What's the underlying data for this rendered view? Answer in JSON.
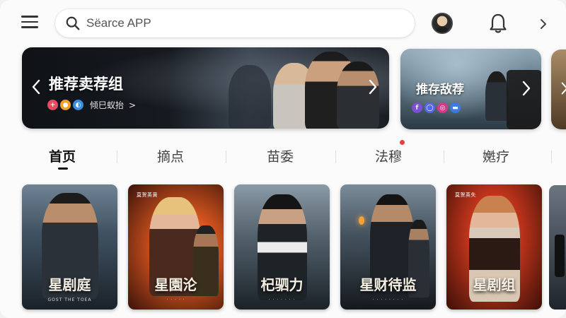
{
  "search": {
    "placeholder": "Sëarce APP"
  },
  "banners": [
    {
      "title": "推荐卖荐组",
      "subtitle": "倾巳蚁抬",
      "chevron": ">",
      "dots": [
        {
          "glyph": "+",
          "color": "#e84a5f"
        },
        {
          "glyph": "●",
          "color": "#f0a030"
        },
        {
          "glyph": "◐",
          "color": "#3a8fe0"
        }
      ]
    },
    {
      "title": "推存敌荐",
      "dots": [
        {
          "glyph": "f",
          "color": "#7b4fd6"
        },
        {
          "glyph": "◯",
          "color": "#5468e8"
        },
        {
          "glyph": "◎",
          "color": "#d6398a"
        },
        {
          "glyph": "▬",
          "color": "#3b7be6"
        }
      ]
    }
  ],
  "tabs": [
    {
      "label": "首页",
      "active": true
    },
    {
      "label": "摘点",
      "active": false
    },
    {
      "label": "苗委",
      "active": false
    },
    {
      "label": "法穆",
      "active": false,
      "badge": true
    },
    {
      "label": "嬎疗",
      "active": false
    }
  ],
  "posters": [
    {
      "title": "星剧庭",
      "top_text": "",
      "foot": "GOST THE TOEA",
      "theme": "#3f5161",
      "theme2": "#1a2229"
    },
    {
      "title": "星園沦",
      "top_text": "莫贺英黄",
      "foot": "· · · · ·",
      "theme": "#d9561f",
      "theme2": "#3a130a"
    },
    {
      "title": "杞驷力",
      "top_text": "",
      "foot": "· · · · · · ·",
      "theme": "#54636e",
      "theme2": "#1b2228"
    },
    {
      "title": "星财待监",
      "top_text": "",
      "foot": "· · · · · · · ·",
      "theme": "#45535f",
      "theme2": "#15191e"
    },
    {
      "title": "星剧组",
      "top_text": "莫贺英失",
      "foot": "· · · · · · ·",
      "theme": "#c7361c",
      "theme2": "#3c0f08"
    }
  ],
  "colors": {
    "accent": "#111111",
    "badge": "#e8433b",
    "background": "#fbfbfb"
  }
}
